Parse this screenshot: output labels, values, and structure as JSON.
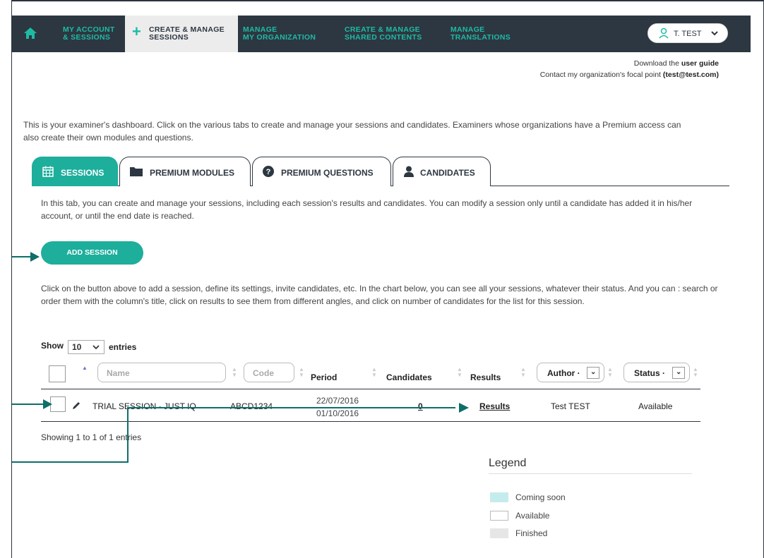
{
  "nav": {
    "items": [
      {
        "label_line1": "MY ACCOUNT",
        "label_line2": "& SESSIONS"
      },
      {
        "label_line1": "CREATE & MANAGE",
        "label_line2": "SESSIONS"
      },
      {
        "label_line1": "MANAGE",
        "label_line2": "MY ORGANIZATION"
      },
      {
        "label_line1": "CREATE & MANAGE",
        "label_line2": "SHARED CONTENTS"
      },
      {
        "label_line1": "MANAGE",
        "label_line2": "TRANSLATIONS"
      }
    ],
    "user_name": "T. TEST"
  },
  "guide": {
    "download_prefix": "Download the ",
    "download_link": "user guide",
    "contact_prefix": "Contact my organization's focal point ",
    "contact_email": "(test@test.com)"
  },
  "intro_text": "This is your examiner's dashboard. Click on the various tabs to create and manage your sessions and candidates. Examiners whose organizations have a Premium access can also create their own modules and questions.",
  "tabs": [
    {
      "label": "SESSIONS",
      "icon": "calendar-icon"
    },
    {
      "label": "PREMIUM MODULES",
      "icon": "folder-icon"
    },
    {
      "label": "PREMIUM QUESTIONS",
      "icon": "question-circle-icon"
    },
    {
      "label": "CANDIDATES",
      "icon": "user-icon"
    }
  ],
  "tab_description": "In this tab, you can create and manage your sessions, including each session's results and candidates. You can modify a session only until a candidate has added it in his/her account, or until the end date is reached.",
  "add_session_label": "ADD SESSION",
  "list_description": "Click on the button above to add a session, define its settings, invite candidates, etc. In the chart below, you can see all your sessions, whatever their status. And you can : search or order them with the column's title, click on results to see them from different angles, and click on number of candidates for the list for this session.",
  "length_menu": {
    "show": "Show",
    "value": "10",
    "entries": "entries"
  },
  "table": {
    "headers": {
      "name_placeholder": "Name",
      "code_placeholder": "Code",
      "period": "Period",
      "candidates": "Candidates",
      "results": "Results",
      "author": "Author ·",
      "status": "Status ·"
    },
    "rows": [
      {
        "name": "TRIAL SESSION - JUST IQ",
        "code": "ABCD1234",
        "period_start": "22/07/2016",
        "period_end": "01/10/2016",
        "candidates": "0",
        "results": "Results",
        "author": "Test TEST",
        "status": "Available"
      }
    ]
  },
  "showing_text": "Showing 1 to 1 of 1 entries",
  "legend": {
    "title": "Legend",
    "items": [
      {
        "label": "Coming soon",
        "color": "#c5ecec"
      },
      {
        "label": "Available",
        "color": "#ffffff"
      },
      {
        "label": "Finished",
        "color": "#e6e6e6"
      }
    ]
  },
  "colors": {
    "nav_bg": "#2d3741",
    "accent": "#1dae9c",
    "arrow": "#0e6e6a"
  }
}
